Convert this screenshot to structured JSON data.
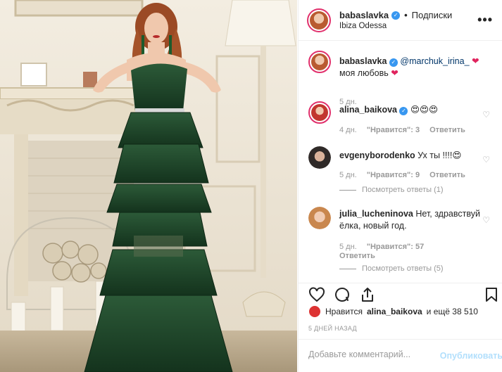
{
  "post": {
    "username": "babaslavka",
    "follow_label": "Подписки",
    "location": "Ibiza Odessa",
    "more_label": "•••"
  },
  "comments": [
    {
      "username": "babaslavka",
      "mention": "@marchuk_irina_",
      "text": "моя любовь",
      "emoji": "❤",
      "time": "5 дн."
    },
    {
      "username": "alina_baikova",
      "text": "😍😍😍",
      "time": "4 дн.",
      "likes": "\"Нравится\": 3",
      "reply": "Ответить"
    },
    {
      "username": "evgenyborodenko",
      "text": "Ух ты !!!!😍",
      "time": "5 дн.",
      "likes": "\"Нравится\": 9",
      "reply": "Ответить",
      "view_replies": "Посмотреть ответы (1)"
    },
    {
      "username": "julia_lucheninova",
      "text": "Нет, здравствуй ёлка, новый год.",
      "time": "5 дн.",
      "likes": "\"Нравится\": 57",
      "reply": "Ответить",
      "view_replies": "Посмотреть ответы (5)"
    }
  ],
  "likes_line": {
    "prefix": "Нравится",
    "user": "alina_baikova",
    "suffix": "и ещё 38 510"
  },
  "date": "5 ДНЕЙ НАЗАД",
  "add_comment": {
    "placeholder": "Добавьте комментарий...",
    "publish": "Опубликовать"
  },
  "icons": [
    "heart-icon",
    "comment-icon",
    "share-icon",
    "bookmark-icon",
    "verified-icon",
    "small-heart-icon"
  ],
  "colors": {
    "accent": "#3897f0",
    "mention": "#003569",
    "muted": "#999999",
    "publish_disabled": "#b2dffc",
    "dress": "#1f4a2c"
  }
}
